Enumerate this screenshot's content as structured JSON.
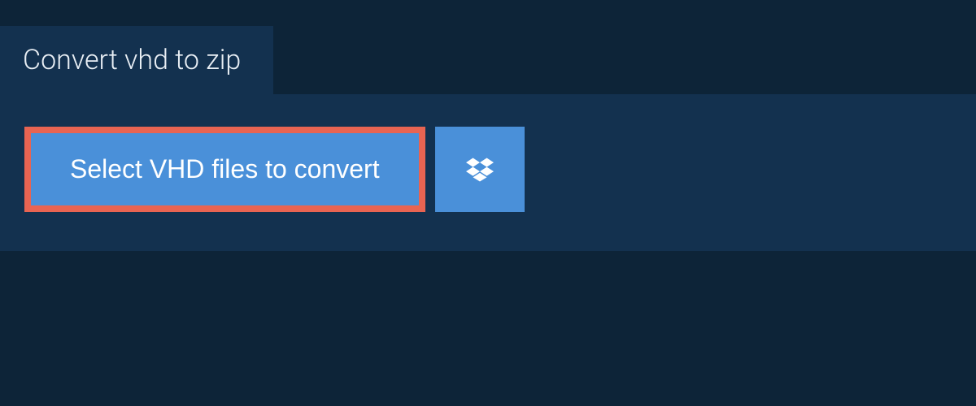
{
  "header": {
    "tab_title": "Convert vhd to zip"
  },
  "main": {
    "select_button_label": "Select VHD files to convert",
    "dropbox_button_title": "Dropbox"
  },
  "colors": {
    "page_bg": "#0d2438",
    "panel_bg": "#13314f",
    "button_bg": "#4a90d9",
    "highlight_border": "#e86452",
    "text_light": "#e8eef4",
    "text_white": "#ffffff"
  },
  "icons": {
    "dropbox": "dropbox-icon"
  }
}
